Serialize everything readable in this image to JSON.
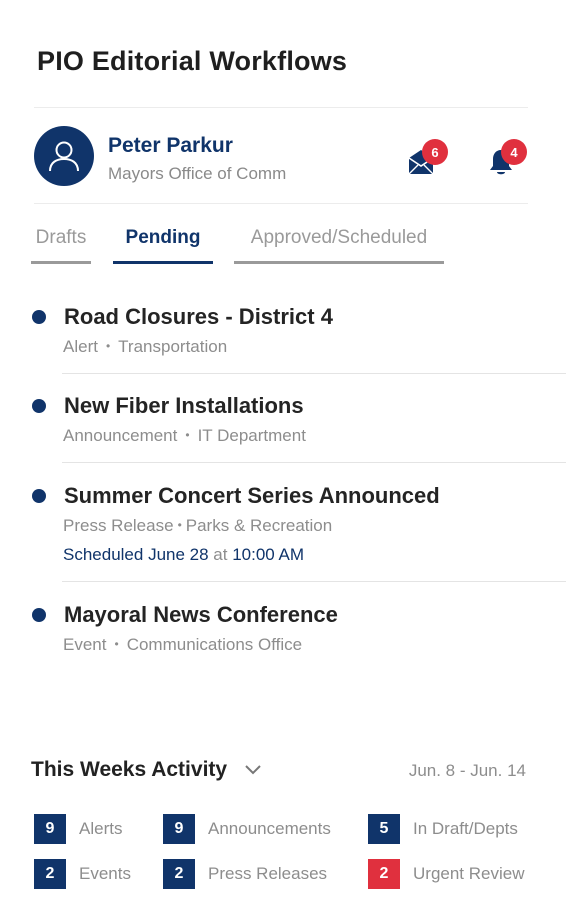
{
  "app": {
    "title": "PIO Editorial Workflows"
  },
  "user": {
    "name": "Peter Parkur",
    "org": "Mayors Office of Comm"
  },
  "notifications": {
    "messages": {
      "count": "6",
      "icon": "mail-icon"
    },
    "alerts": {
      "count": "4",
      "icon": "bell-icon"
    }
  },
  "tabs": [
    {
      "label": "Drafts",
      "active": false
    },
    {
      "label": "Pending",
      "active": true
    },
    {
      "label": "Approved/Scheduled",
      "active": false
    }
  ],
  "items": [
    {
      "title": "Road Closures - District 4",
      "type": "Alert",
      "dept": "Transportation"
    },
    {
      "title": "New Fiber Installations",
      "type": "Announcement",
      "dept": "IT Department"
    },
    {
      "title": "Summer Concert Series Announced",
      "type": "Press Release",
      "dept": "Parks & Recreation",
      "schedule": {
        "date": "Scheduled June 28",
        "at": "at",
        "time": "10:00 AM"
      }
    },
    {
      "title": "Mayoral News Conference",
      "type": "Event",
      "dept": "Communications Office"
    }
  ],
  "activity": {
    "title": "This Weeks Activity",
    "range": "Jun. 8 - Jun. 14",
    "stats": [
      {
        "count": "9",
        "label": "Alerts"
      },
      {
        "count": "9",
        "label": "Announcements"
      },
      {
        "count": "5",
        "label": "In Draft/Depts"
      },
      {
        "count": "2",
        "label": "Events"
      },
      {
        "count": "2",
        "label": "Press Releases"
      },
      {
        "count": "2",
        "label": "Urgent Review"
      }
    ]
  },
  "colors": {
    "brand": "#10346a",
    "badge": "#e0303e",
    "muted": "#8d8d8d"
  }
}
